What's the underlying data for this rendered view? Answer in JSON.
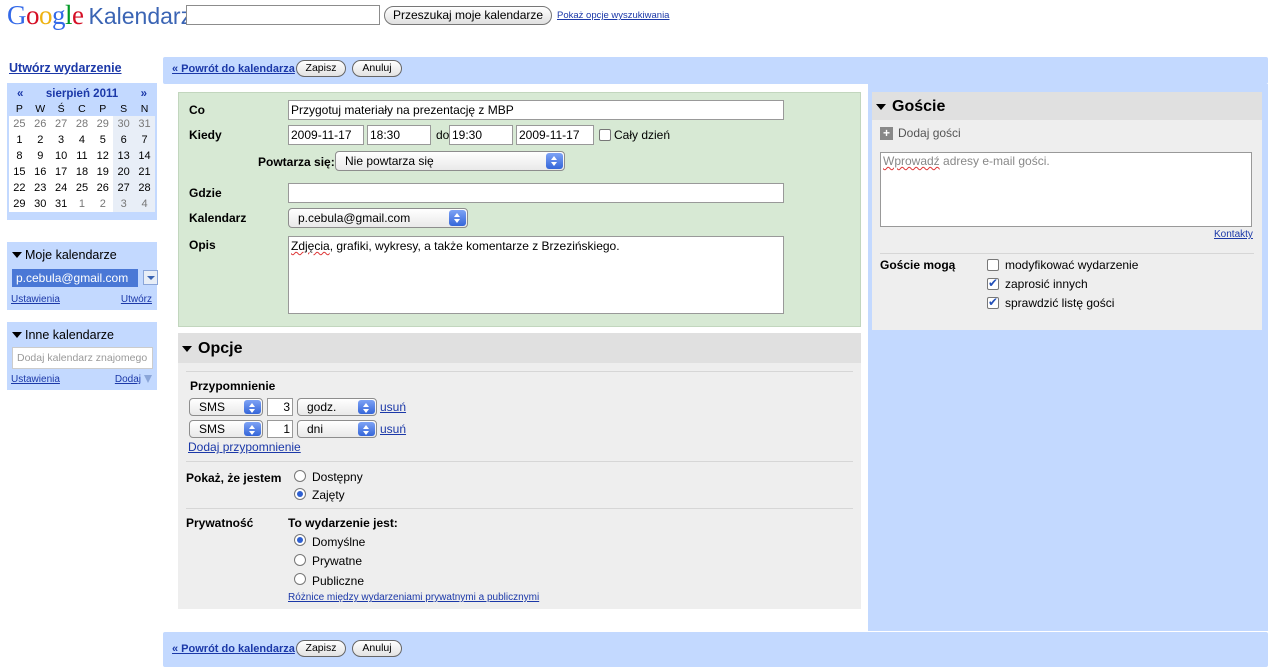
{
  "header": {
    "logo_google": "Google",
    "logo_product": "Kalendarz",
    "search_button": "Przeszukaj moje kalendarze",
    "search_options_link": "Pokaż opcje wyszukiwania"
  },
  "sidebar": {
    "create_event": "Utwórz wydarzenie",
    "mini_calendar": {
      "prev": "«",
      "next": "»",
      "month": "sierpień 2011",
      "weekdays": [
        "P",
        "W",
        "Ś",
        "C",
        "P",
        "S",
        "N"
      ],
      "weeks": [
        [
          "25",
          "26",
          "27",
          "28",
          "29",
          "30",
          "31"
        ],
        [
          "1",
          "2",
          "3",
          "4",
          "5",
          "6",
          "7"
        ],
        [
          "8",
          "9",
          "10",
          "11",
          "12",
          "13",
          "14"
        ],
        [
          "15",
          "16",
          "17",
          "18",
          "19",
          "20",
          "21"
        ],
        [
          "22",
          "23",
          "24",
          "25",
          "26",
          "27",
          "28"
        ],
        [
          "29",
          "30",
          "31",
          "1",
          "2",
          "3",
          "4"
        ]
      ]
    },
    "my_calendars": {
      "title": "Moje kalendarze",
      "calendar": "p.cebula@gmail.com",
      "settings": "Ustawienia",
      "create": "Utwórz"
    },
    "other_calendars": {
      "title": "Inne kalendarze",
      "placeholder": "Dodaj kalendarz znajomego",
      "settings": "Ustawienia",
      "add": "Dodaj"
    }
  },
  "bar": {
    "back": "« Powrót do kalendarza",
    "save": "Zapisz",
    "cancel": "Anuluj"
  },
  "details": {
    "what_label": "Co",
    "what_value": "Przygotuj materiały na prezentację z MBP",
    "when_label": "Kiedy",
    "start_date": "2009-11-17",
    "start_time": "18:30",
    "to_label": "do",
    "end_time": "19:30",
    "end_date": "2009-11-17",
    "all_day": "Cały dzień",
    "repeat_label": "Powtarza się:",
    "repeat_value": "Nie powtarza się",
    "where_label": "Gdzie",
    "where_value": "",
    "calendar_label": "Kalendarz",
    "calendar_value": "p.cebula@gmail.com",
    "desc_label": "Opis",
    "desc_word1": "Zdjęcia",
    "desc_rest": ", grafiki, wykresy, a także komentarze z Brzezińskiego."
  },
  "options": {
    "title": "Opcje",
    "reminder_label": "Przypomnienie",
    "reminders": [
      {
        "method": "SMS",
        "amount": "3",
        "unit": "godz.",
        "remove": "usuń"
      },
      {
        "method": "SMS",
        "amount": "1",
        "unit": "dni",
        "remove": "usuń"
      }
    ],
    "add_reminder": "Dodaj przypomnienie",
    "show_as_label": "Pokaż, że jestem",
    "show_as": [
      "Dostępny",
      "Zajęty"
    ],
    "show_as_selected": "Zajęty",
    "privacy_label": "Prywatność",
    "privacy_sub": "To wydarzenie jest:",
    "privacy": [
      "Domyślne",
      "Prywatne",
      "Publiczne"
    ],
    "privacy_selected": "Domyślne",
    "privacy_link": "Różnice między wydarzeniami prywatnymi a publicznymi"
  },
  "guests": {
    "title": "Goście",
    "add_guests": "Dodaj gości",
    "placeholder_word1": "Wprowadź",
    "placeholder_rest": " adresy e-mail gości.",
    "contacts": "Kontakty",
    "can_label": "Goście mogą",
    "permissions": [
      {
        "label": "modyfikować wydarzenie",
        "checked": false
      },
      {
        "label": "zaprosić innych",
        "checked": true
      },
      {
        "label": "sprawdzić listę gości",
        "checked": true
      }
    ]
  }
}
